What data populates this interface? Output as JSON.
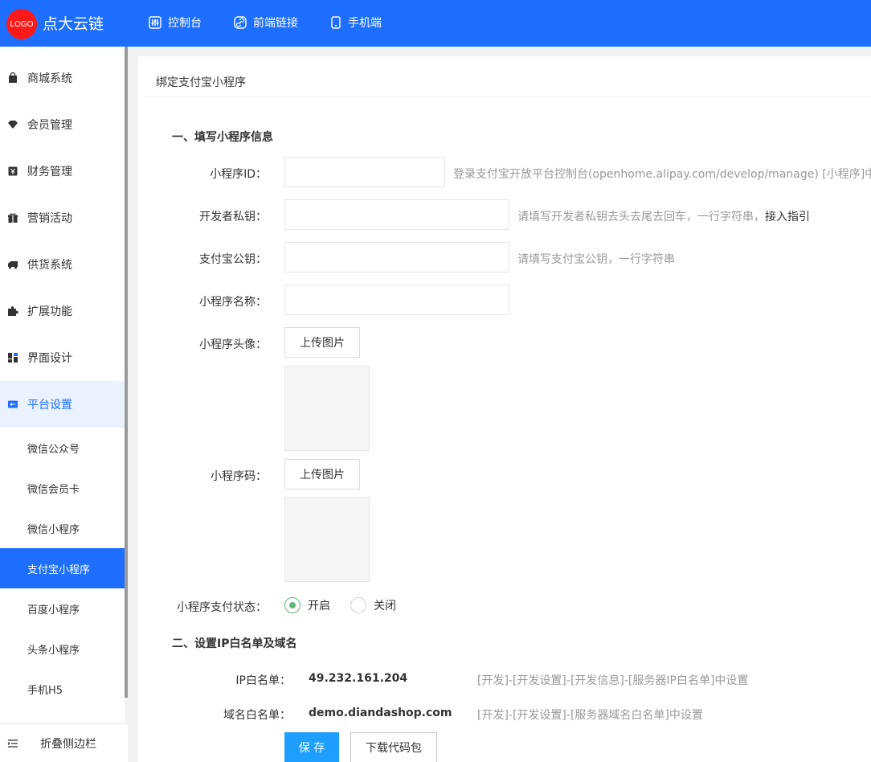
{
  "header": {
    "logo_text": "LOGO",
    "brand": "点大云链",
    "nav": [
      {
        "label": "控制台",
        "icon": "dashboard-icon"
      },
      {
        "label": "前端链接",
        "icon": "link-icon"
      },
      {
        "label": "手机端",
        "icon": "phone-icon"
      }
    ]
  },
  "sidebar": {
    "items": [
      {
        "label": "商城系统",
        "icon": "shopping-bag-icon"
      },
      {
        "label": "会员管理",
        "icon": "diamond-icon"
      },
      {
        "label": "财务管理",
        "icon": "finance-icon"
      },
      {
        "label": "营销活动",
        "icon": "gift-icon"
      },
      {
        "label": "供货系统",
        "icon": "truck-icon"
      },
      {
        "label": "扩展功能",
        "icon": "puzzle-icon"
      },
      {
        "label": "界面设计",
        "icon": "layout-icon"
      },
      {
        "label": "平台设置",
        "icon": "platform-icon"
      }
    ],
    "sub_items": [
      {
        "label": "微信公众号"
      },
      {
        "label": "微信会员卡"
      },
      {
        "label": "微信小程序"
      },
      {
        "label": "支付宝小程序"
      },
      {
        "label": "百度小程序"
      },
      {
        "label": "头条小程序"
      },
      {
        "label": "手机H5"
      }
    ],
    "collapse_label": "折叠侧边栏"
  },
  "main": {
    "title": "绑定支付宝小程序",
    "section1": "一、填写小程序信息",
    "fields": {
      "app_id": {
        "label": "小程序ID：",
        "value": "",
        "hint": "登录支付宝开放平台控制台(openhome.alipay.com/develop/manage) [小程序]中查找"
      },
      "private_key": {
        "label": "开发者私钥：",
        "value": "",
        "hint": "请填写开发者私钥去头去尾去回车，一行字符串，",
        "hint_link": "接入指引"
      },
      "public_key": {
        "label": "支付宝公钥：",
        "value": "",
        "hint": "请填写支付宝公钥，一行字符串"
      },
      "app_name": {
        "label": "小程序名称：",
        "value": ""
      },
      "avatar": {
        "label": "小程序头像：",
        "button": "上传图片"
      },
      "qrcode": {
        "label": "小程序码：",
        "button": "上传图片"
      },
      "pay_status": {
        "label": "小程序支付状态：",
        "on_label": "开启",
        "off_label": "关闭"
      }
    },
    "section2": "二、设置IP白名单及域名",
    "ip_whitelist": {
      "label": "IP白名单：",
      "value": "49.232.161.204",
      "hint": "[开发]-[开发设置]-[开发信息]-[服务器IP白名单]中设置"
    },
    "domain_whitelist": {
      "label": "域名白名单：",
      "value": "demo.diandashop.com",
      "hint": "[开发]-[开发设置]-[服务器域名白名单]中设置"
    },
    "save_label": "保 存",
    "download_label": "下载代码包"
  }
}
